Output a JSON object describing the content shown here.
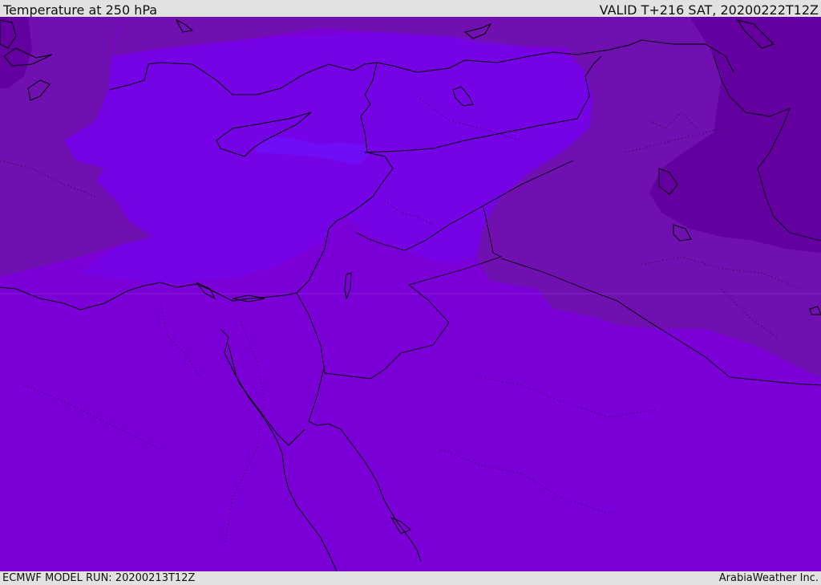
{
  "header": {
    "title": "Temperature at 250 hPa",
    "valid": "VALID T+216 SAT, 20200222T12Z"
  },
  "footer": {
    "model_run": "ECMWF MODEL RUN: 20200213T12Z",
    "credit": "ArabiaWeather Inc."
  },
  "colors": {
    "base_band": "#7b00d8",
    "warm_band": "#7305f0",
    "warmest_band": "#6a18ff",
    "cool_band": "#7010b0",
    "cold_band": "#6400a0",
    "coastline": "#000000",
    "background": "#e2e2e2"
  }
}
